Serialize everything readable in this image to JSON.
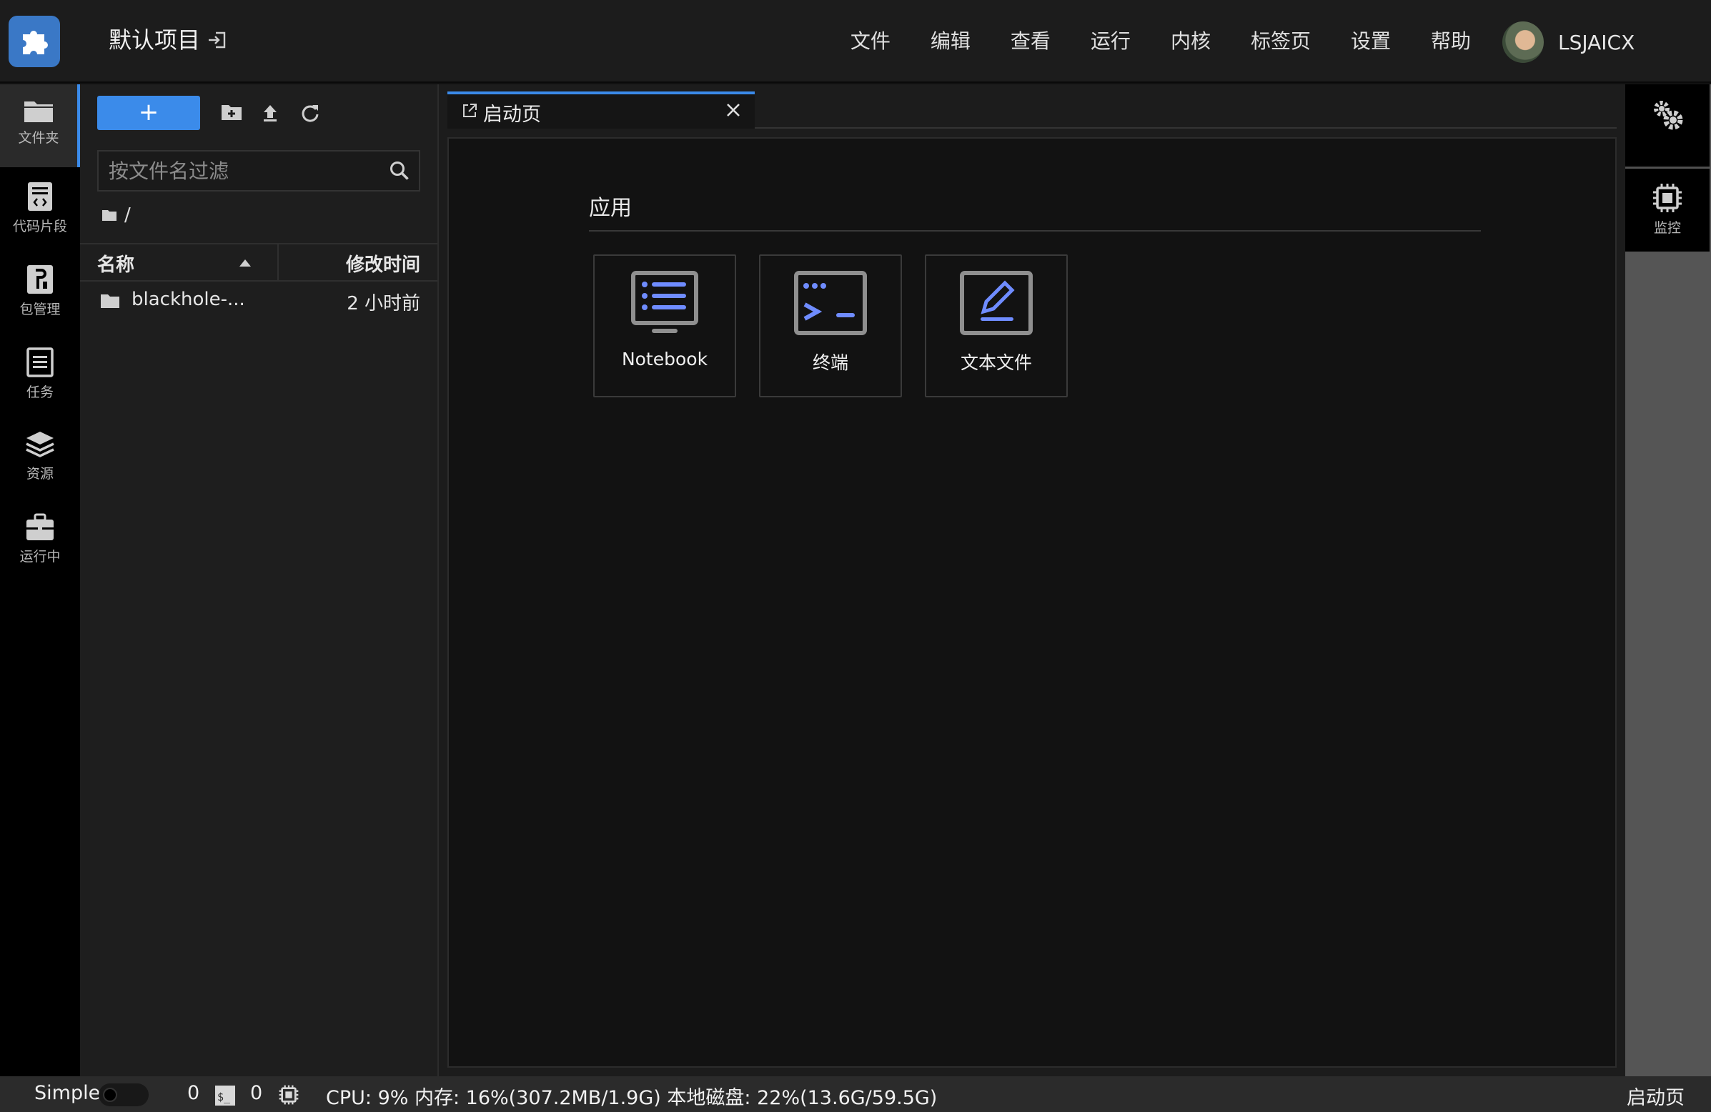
{
  "app": {
    "project_title": "默认项目",
    "logo_icon": "puzzle-piece-icon",
    "accent_color": "#3b8bea"
  },
  "menu": {
    "items": [
      "文件",
      "编辑",
      "查看",
      "运行",
      "内核",
      "标签页",
      "设置",
      "帮助"
    ]
  },
  "user": {
    "name": "LSJAICX"
  },
  "left_rail": {
    "items": [
      {
        "label": "文件夹",
        "icon": "folder-icon",
        "active": true
      },
      {
        "label": "代码片段",
        "icon": "code-snippet-icon"
      },
      {
        "label": "包管理",
        "icon": "package-icon"
      },
      {
        "label": "任务",
        "icon": "task-list-icon"
      },
      {
        "label": "资源",
        "icon": "layers-icon"
      },
      {
        "label": "运行中",
        "icon": "briefcase-icon"
      }
    ]
  },
  "file_browser": {
    "new_button_label": "+",
    "search_placeholder": "按文件名过滤",
    "path": "/",
    "columns": {
      "name": "名称",
      "modified": "修改时间"
    },
    "files": [
      {
        "name": "blackhole-...",
        "modified": "2 小时前",
        "type": "folder"
      }
    ]
  },
  "tabs": [
    {
      "label": "启动页",
      "active": true
    }
  ],
  "launcher": {
    "section_title": "应用",
    "cards": [
      {
        "label": "Notebook",
        "icon": "notebook-icon"
      },
      {
        "label": "终端",
        "icon": "terminal-icon"
      },
      {
        "label": "文本文件",
        "icon": "text-editor-icon"
      }
    ]
  },
  "right_rail": {
    "top_icon": "settings-gears-icon",
    "items": [
      {
        "label": "监控",
        "icon": "cpu-chip-icon"
      }
    ]
  },
  "status_bar": {
    "mode_label": "Simple",
    "terminals_count": "0",
    "kernels_count": "0",
    "resources": "CPU:  9% 内存:  16%(307.2MB/1.9G) 本地磁盘:  22%(13.6G/59.5G)",
    "current_tab": "启动页"
  }
}
